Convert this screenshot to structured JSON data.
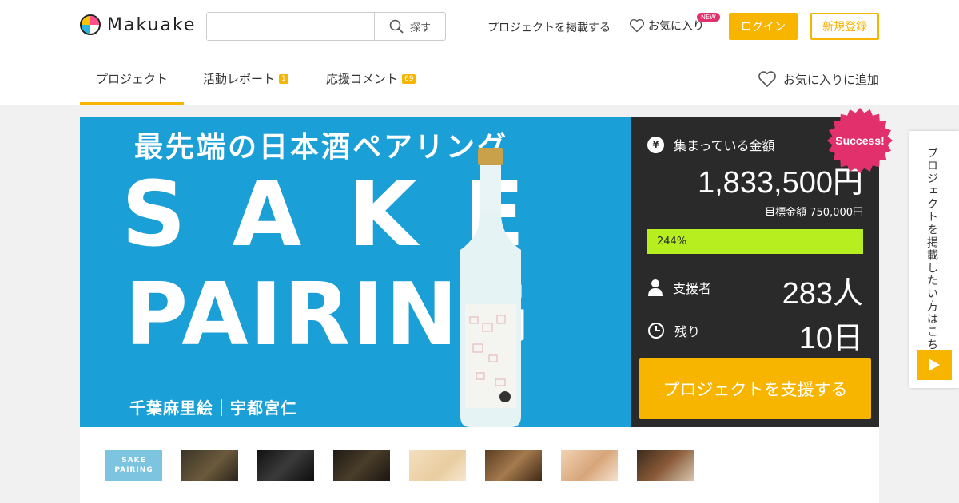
{
  "header": {
    "logo_text": "Makuake",
    "search_placeholder": "",
    "search_button": "探す",
    "post_project": "プロジェクトを掲載する",
    "favorites": "お気に入り",
    "new_badge": "NEW",
    "login": "ログイン",
    "signup": "新規登録"
  },
  "tabs": [
    {
      "label": "プロジェクト",
      "badge": ""
    },
    {
      "label": "活動レポート",
      "badge": "1"
    },
    {
      "label": "応援コメント",
      "badge": "69"
    }
  ],
  "add_favorite": "お気に入りに追加",
  "hero": {
    "subtitle": "最先端の日本酒ペアリング",
    "title_line1": "SAKE",
    "title_line2": "PAIRING",
    "names": "千葉麻里絵｜宇都宮仁"
  },
  "stats": {
    "collected_label": "集まっている金額",
    "amount": "1,833,500円",
    "goal": "目標金額 750,000円",
    "progress_text": "244%",
    "progress_fraction": 1.0,
    "supporters_label": "支援者",
    "supporters": "283人",
    "remaining_label": "残り",
    "remaining": "10日",
    "support_button": "プロジェクトを支援する",
    "success_badge": "Success!"
  },
  "side_tab": {
    "text": "プロジェクトを掲載したい方はこちら"
  },
  "thumbnails": [
    {
      "name": "thumb-1",
      "text": "SAKE PAIRING"
    },
    {
      "name": "thumb-2",
      "text": ""
    },
    {
      "name": "thumb-3",
      "text": ""
    },
    {
      "name": "thumb-4",
      "text": ""
    },
    {
      "name": "thumb-5",
      "text": ""
    },
    {
      "name": "thumb-6",
      "text": ""
    },
    {
      "name": "thumb-7",
      "text": ""
    },
    {
      "name": "thumb-8",
      "text": ""
    }
  ],
  "colors": {
    "accent": "#f7b500",
    "hero_bg": "#1a9fd6",
    "panel_bg": "#2a2a2a",
    "progress": "#b7ee1f",
    "badge_pink": "#e2306c"
  }
}
